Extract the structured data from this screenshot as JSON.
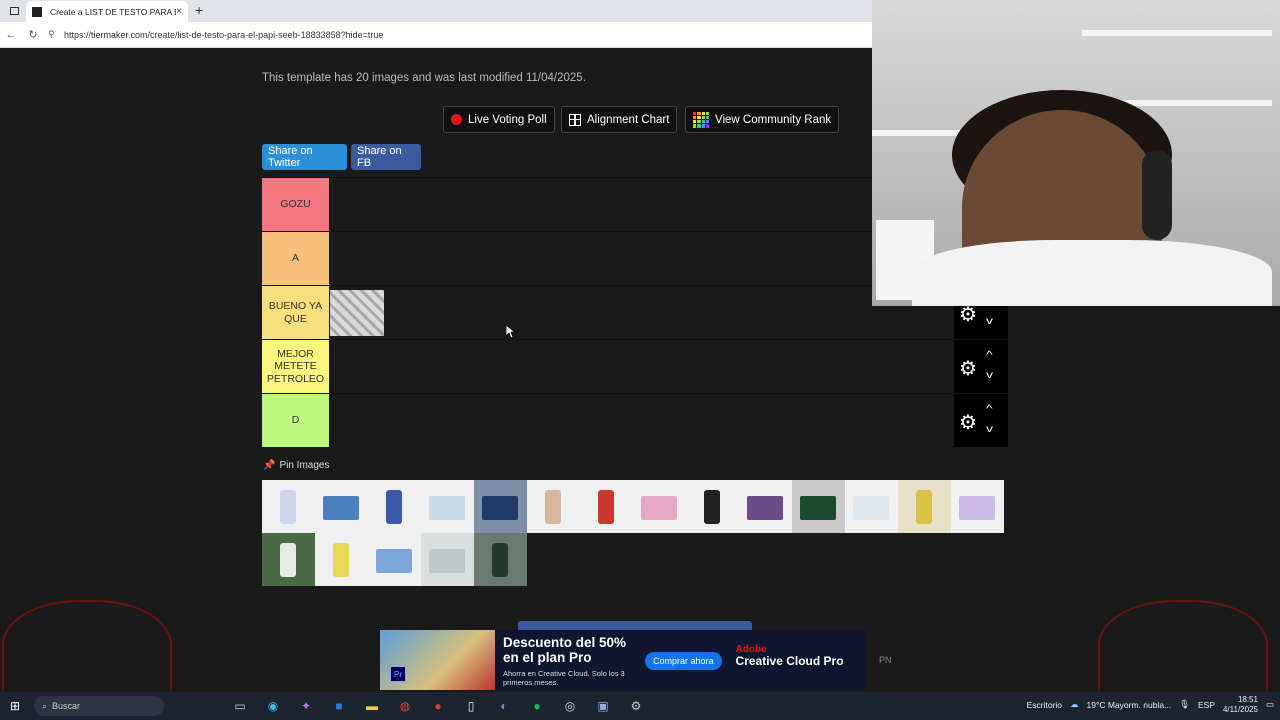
{
  "browser": {
    "tab_title": "Create a LIST DE TESTO PARA EL",
    "tab_close": "×",
    "new_tab": "+",
    "url": "https://tiermaker.com/create/list-de-testo-para-el-papi-seeb-18833858?hide=true"
  },
  "page": {
    "template_info": "This template has 20 images and was last modified 11/04/2025.",
    "buttons": {
      "live_voting": "Live Voting Poll",
      "alignment_chart": "Alignment Chart",
      "community_rank": "View Community Rank"
    },
    "share": {
      "twitter": "Share on Twitter",
      "facebook": "Share on FB"
    },
    "tiers": [
      {
        "label": "GOZU",
        "color": "#f2777f"
      },
      {
        "label": "A",
        "color": "#f7be7c"
      },
      {
        "label": "BUENO YA QUE",
        "color": "#f8df7d"
      },
      {
        "label": "MEJOR METETE PETROLEO",
        "color": "#f8f67f"
      },
      {
        "label": "D",
        "color": "#bef77e"
      }
    ],
    "pin_images": "Pin Images",
    "pool_count": 20
  },
  "ad": {
    "headline": "Descuento del 50% en el plan Pro",
    "subtext": "Ahorra en Creative Cloud. Solo los 3 primeros meses.",
    "cta": "Comprar ahora",
    "brand_top": "Adobe",
    "brand": "Creative Cloud Pro",
    "product_badge": "Pr"
  },
  "misc": {
    "pn": "PN"
  },
  "taskbar": {
    "search": "Buscar",
    "desktop": "Escritorio",
    "weather": "19°C  Mayorm. nubla...",
    "lang": "ESP",
    "time": "18:51",
    "date": "4/11/2025"
  },
  "colors": {
    "share_twitter": "#2b8fd8",
    "share_fb": "#3b5b9e",
    "live_dot": "#e0161b"
  }
}
